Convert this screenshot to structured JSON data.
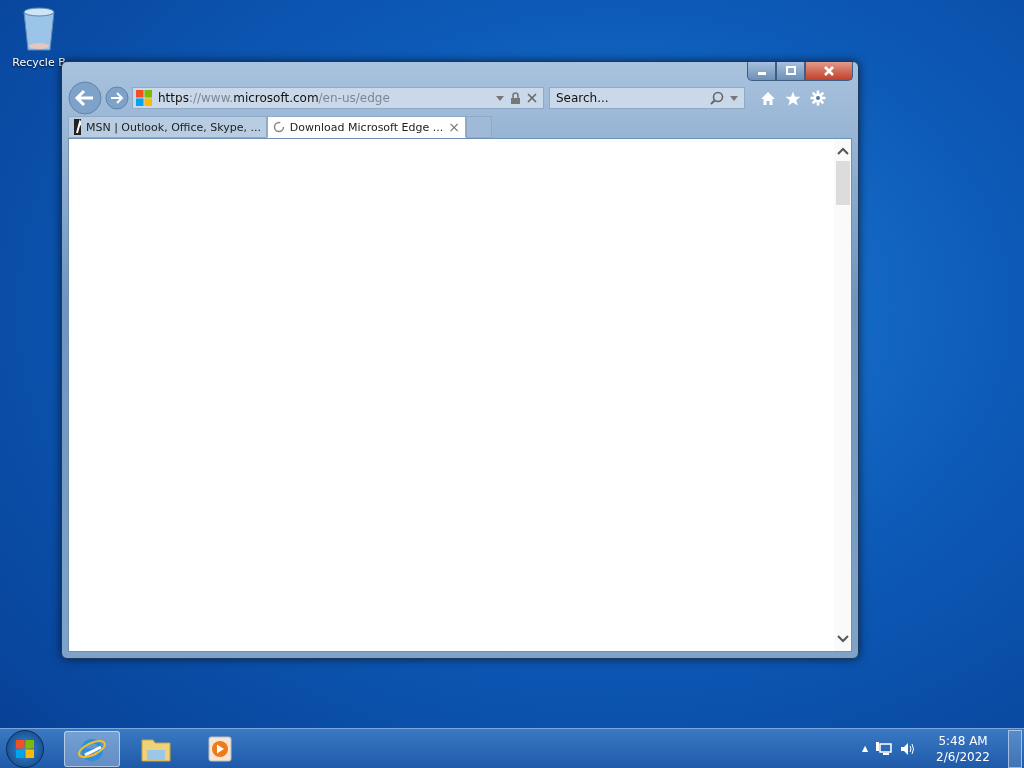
{
  "desktop_icons": [
    {
      "label": "Recycle B"
    }
  ],
  "browser": {
    "url_parts": [
      {
        "text": "https",
        "dim": false
      },
      {
        "text": "://www.",
        "dim": true
      },
      {
        "text": "microsoft.com",
        "dim": false
      },
      {
        "text": "/en-us/edge",
        "dim": true
      }
    ],
    "search": {
      "placeholder": "Search..."
    },
    "tabs": [
      {
        "label": "MSN | Outlook, Office, Skype, ...",
        "selected": false,
        "loading": false
      },
      {
        "label": "Download Microsoft Edge ...",
        "selected": true,
        "loading": true,
        "close": "×"
      }
    ]
  },
  "taskbar": {
    "apps": [
      {
        "kind": "ie",
        "selected": true
      },
      {
        "kind": "explorer",
        "selected": false
      },
      {
        "kind": "media",
        "selected": false
      }
    ],
    "tray_arrow": "▲",
    "time": "5:48 AM",
    "date": "2/6/2022"
  }
}
